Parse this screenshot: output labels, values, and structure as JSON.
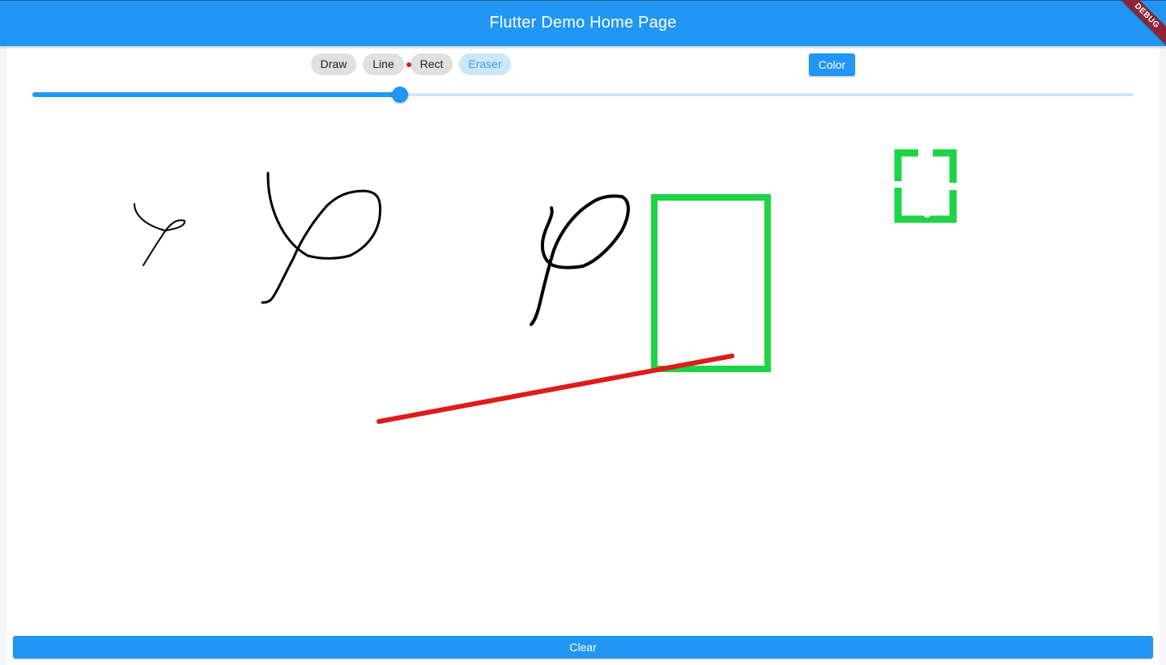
{
  "app_bar": {
    "title": "Flutter Demo Home Page",
    "debug_label": "DEBUG",
    "color": "#2196f3"
  },
  "toolbar": {
    "tools": [
      {
        "label": "Draw",
        "selected": false
      },
      {
        "label": "Line",
        "selected": false
      },
      {
        "label": "Rect",
        "selected": false
      },
      {
        "label": "Eraser",
        "selected": true
      }
    ],
    "color_button_label": "Color"
  },
  "slider": {
    "value_fraction": 0.334,
    "active_color": "#2196f3",
    "inactive_color": "#cfe6fb"
  },
  "canvas": {
    "strokes": [
      {
        "kind": "freehand",
        "color": "#000000"
      },
      {
        "kind": "freehand",
        "color": "#000000"
      },
      {
        "kind": "freehand",
        "color": "#000000"
      },
      {
        "kind": "line",
        "color": "#dd1c1c"
      },
      {
        "kind": "rect",
        "color": "#1ed445"
      },
      {
        "kind": "rect-erased",
        "color": "#1ed445"
      }
    ]
  },
  "footer": {
    "clear_label": "Clear"
  }
}
